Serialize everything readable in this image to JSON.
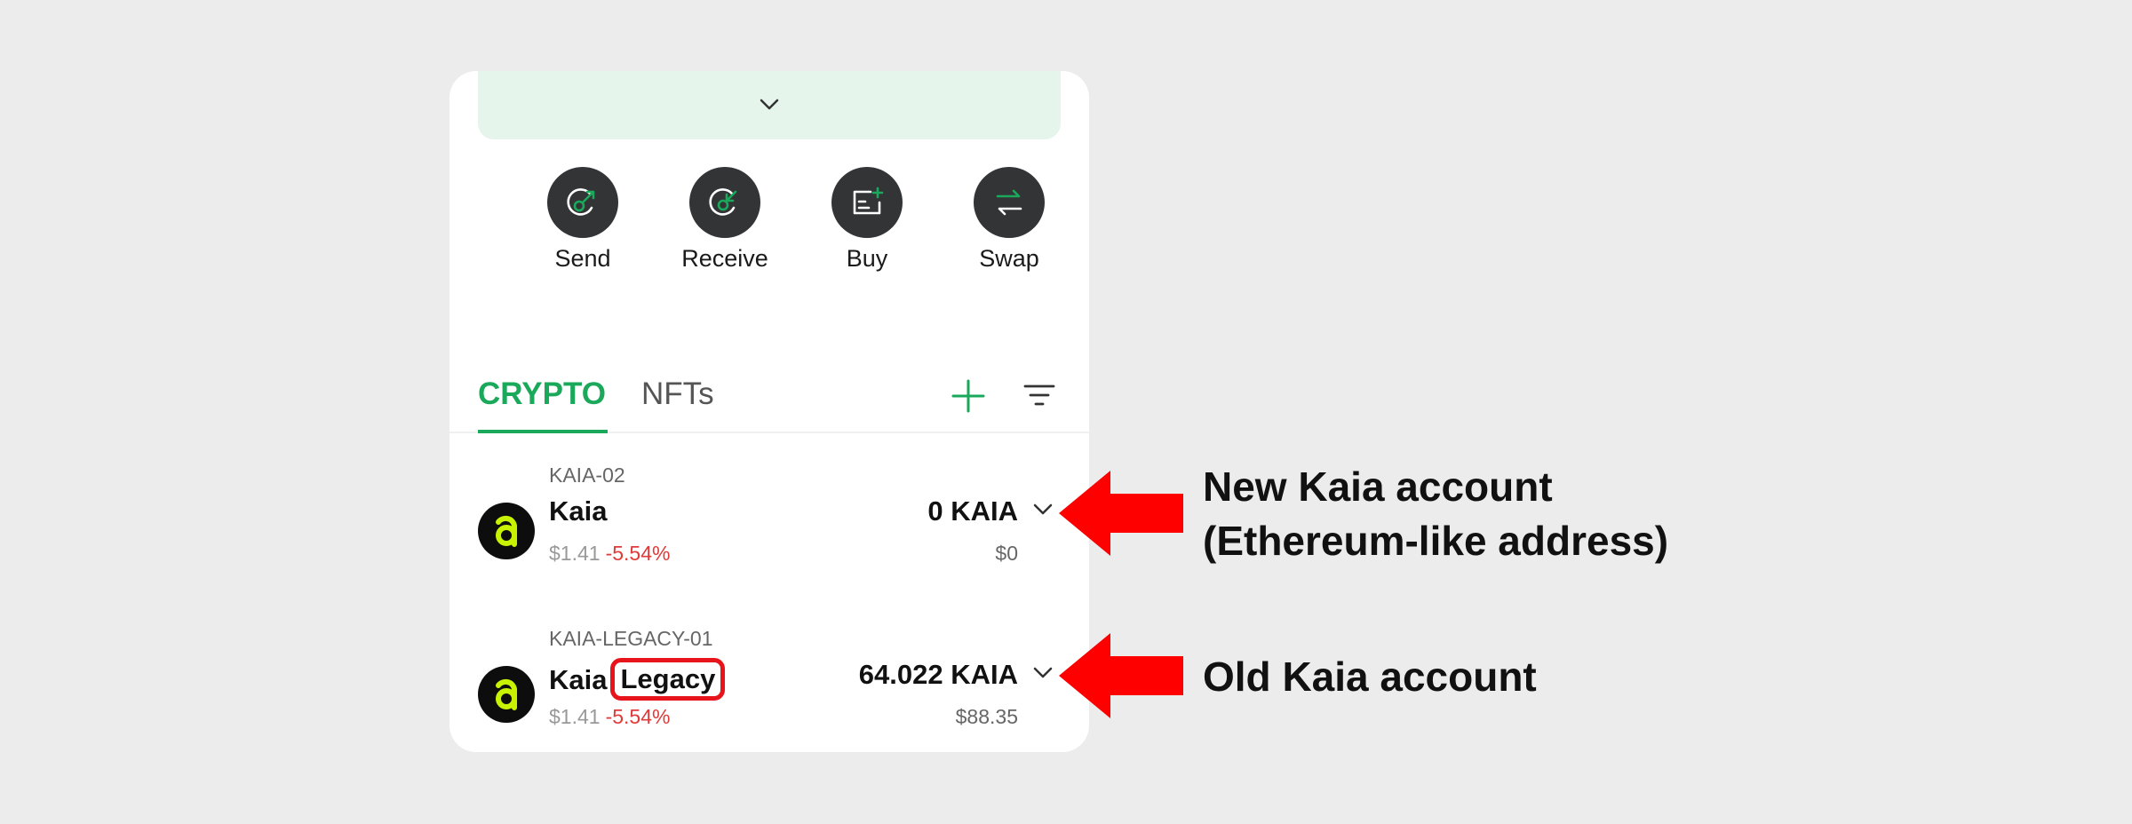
{
  "balance": {
    "partial_text": ", , ,"
  },
  "actions": [
    {
      "label": "Send",
      "icon": "send-icon"
    },
    {
      "label": "Receive",
      "icon": "receive-icon"
    },
    {
      "label": "Buy",
      "icon": "buy-icon"
    },
    {
      "label": "Swap",
      "icon": "swap-icon"
    }
  ],
  "tabs": {
    "crypto": "CRYPTO",
    "nfts": "NFTs"
  },
  "colors": {
    "accent": "#1aa85a",
    "negative": "#e03a3a",
    "highlight": "#e8141c",
    "logo_glyph": "#c7f200"
  },
  "assets": [
    {
      "account": "KAIA-02",
      "name": "Kaia",
      "tag": "",
      "price": "$1.41",
      "change": "-5.54%",
      "amount": "0 KAIA",
      "fiat": "$0"
    },
    {
      "account": "KAIA-LEGACY-01",
      "name": "Kaia",
      "tag": "Legacy",
      "price": "$1.41",
      "change": "-5.54%",
      "amount": "64.022 KAIA",
      "fiat": "$88.35"
    }
  ],
  "annotations": {
    "new_account_line1": "New Kaia account",
    "new_account_line2": "(Ethereum-like address)",
    "old_account": "Old Kaia account"
  }
}
